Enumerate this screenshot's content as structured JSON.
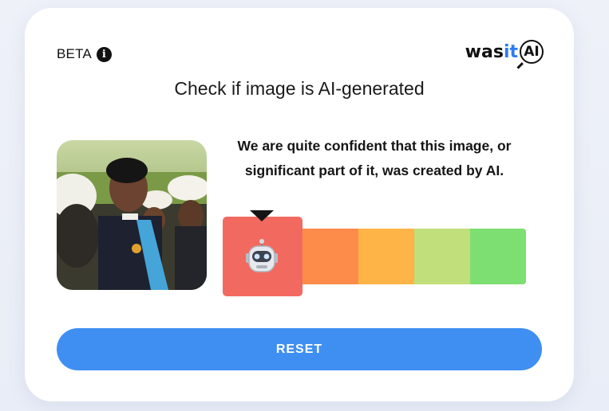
{
  "header": {
    "beta_label": "BETA",
    "info_icon": "info-icon",
    "logo": {
      "prefix": "was",
      "highlight": "it",
      "badge": "AI"
    }
  },
  "main": {
    "title": "Check if image is AI-generated",
    "result_line1": "We are quite confident that this image, or",
    "result_line2": "significant part of it, was created by AI.",
    "meter": {
      "selected_index": 0,
      "segment_colors": [
        "#f26a5f",
        "#fd8c4b",
        "#feb446",
        "#c1df7a",
        "#7ddf72"
      ],
      "indicator_icon": "robot-icon"
    },
    "photo_icon": "uploaded-image"
  },
  "actions": {
    "reset_label": "RESET"
  },
  "colors": {
    "accent": "#3f8ff2",
    "highlight": "#2f7bf5"
  }
}
